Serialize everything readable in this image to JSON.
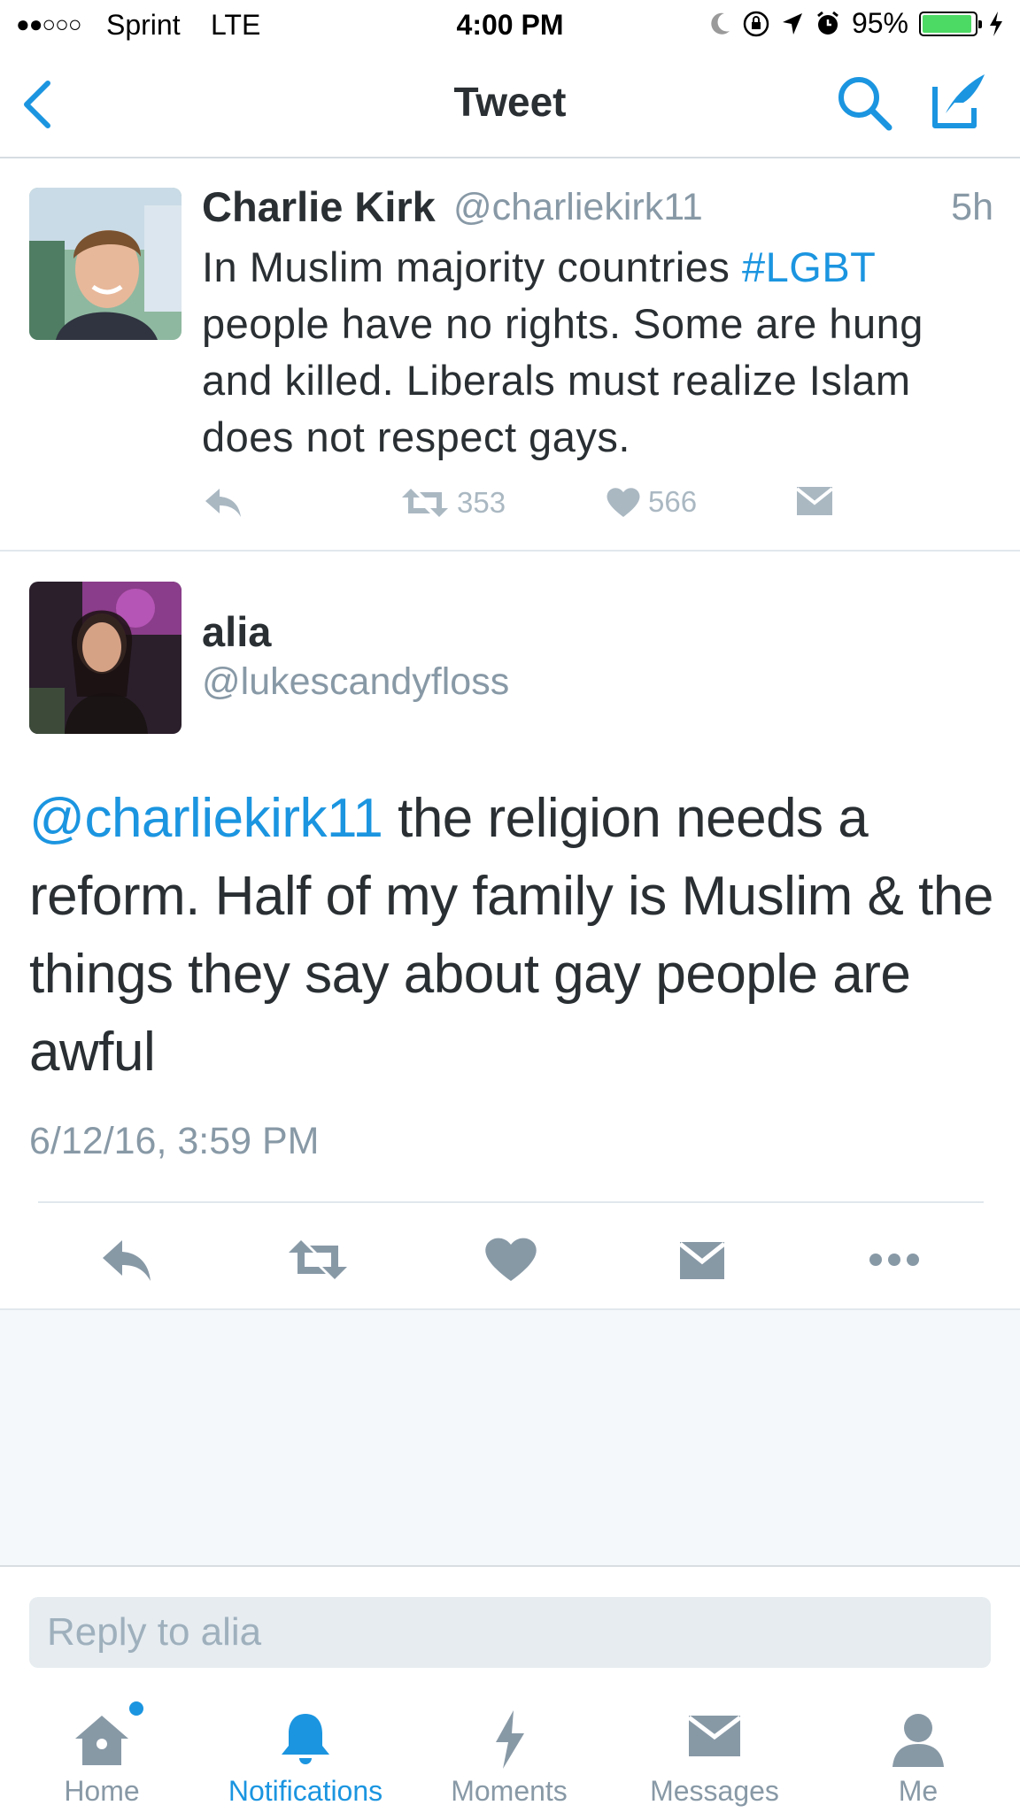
{
  "status_bar": {
    "signal_dots": "●●○○○",
    "carrier": "Sprint",
    "network": "LTE",
    "time": "4:00 PM",
    "battery": "95%",
    "battery_level": 0.95
  },
  "nav": {
    "title": "Tweet",
    "back_icon": "chevron-left-icon",
    "search_icon": "search-icon",
    "compose_icon": "compose-icon"
  },
  "original_tweet": {
    "name": "Charlie Kirk",
    "handle": "@charliekirk11",
    "time": "5h",
    "text_before": "In Muslim majority countries ",
    "hashtag": "#LGBT",
    "text_after": " people have no rights. Some are hung and killed. Liberals must realize Islam does not respect gays.",
    "retweets": "353",
    "likes": "566"
  },
  "reply_tweet": {
    "name": "alia",
    "handle": "@lukescandyfloss",
    "mention": "@charliekirk11",
    "text": " the religion needs a reform. Half of my family is Muslim & the things they say about gay people are awful",
    "datetime": "6/12/16, 3:59 PM"
  },
  "reply_box": {
    "placeholder": "Reply to alia"
  },
  "tabs": [
    {
      "label": "Home",
      "icon": "home-icon"
    },
    {
      "label": "Notifications",
      "icon": "bell-icon"
    },
    {
      "label": "Moments",
      "icon": "lightning-icon"
    },
    {
      "label": "Messages",
      "icon": "envelope-icon"
    },
    {
      "label": "Me",
      "icon": "person-icon"
    }
  ],
  "colors": {
    "accent": "#1b95e0",
    "text": "#292f33",
    "muted": "#8899a6",
    "icon_gray": "#aab8c2",
    "empty_bg": "#f5f8fa"
  }
}
